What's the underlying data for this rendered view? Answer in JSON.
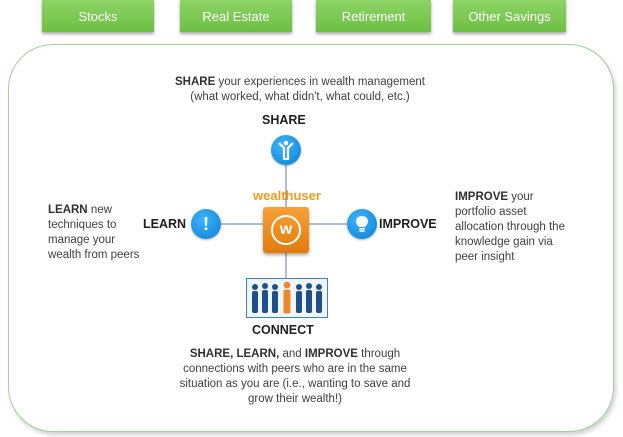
{
  "tabs": {
    "stocks": "Stocks",
    "real_estate": "Real Estate",
    "retirement": "Retirement",
    "other_savings": "Other Savings"
  },
  "share": {
    "heading": "SHARE",
    "desc_bold": "SHARE",
    "desc_rest": "your experiences in wealth management",
    "desc_line2": "(what worked, what didn't, what could, etc.)"
  },
  "learn": {
    "heading": "LEARN",
    "desc_bold": "LEARN",
    "desc_l1": "new",
    "desc_l2": "techniques to",
    "desc_l3": "manage your",
    "desc_l4": "wealth from peers"
  },
  "improve": {
    "heading": "IMPROVE",
    "desc_bold": "IMPROVE",
    "desc_l1": "your",
    "desc_l2": "portfolio asset",
    "desc_l3": "allocation through the",
    "desc_l4": "knowledge gain via",
    "desc_l5": "peer insight"
  },
  "center": {
    "brand": "wealthuser",
    "logo_letter": "w"
  },
  "connect": {
    "heading": "CONNECT",
    "b1": "SHARE,",
    "b2": "LEARN,",
    "and": "and",
    "b3": "IMPROVE",
    "l1_rest": "through",
    "l2": "connections with peers who are in the same",
    "l3": "situation as you are (i.e., wanting to save and",
    "l4": "grow their wealth!)"
  },
  "colors": {
    "tab_green": "#6cbf43",
    "icon_blue": "#0b7fd0",
    "brand_orange": "#f39a1a",
    "panel_border": "#9ed39a"
  },
  "icons": {
    "share": "person-arms-up-icon",
    "learn": "exclamation-icon",
    "improve": "lightbulb-icon",
    "connect": "people-group-icon"
  }
}
